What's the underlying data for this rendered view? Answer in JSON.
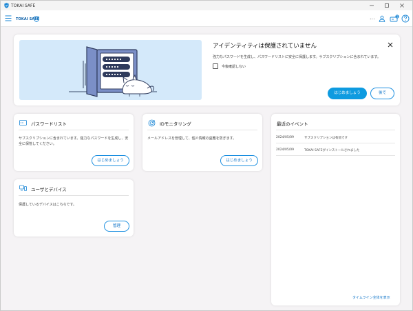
{
  "window": {
    "title": "TOKAI SAFE"
  },
  "toolbar": {
    "logo": "TOKAI SAFE",
    "more": "...",
    "badge": "1"
  },
  "banner": {
    "title": "アイデンティティは保護されていません",
    "description": "強力なパスワードを生成し、パスワードリストに安全に保護します。サブスクリプションに含まれています。",
    "checkbox_label": "今後確認しない",
    "start_button": "はじめましょう",
    "later_button": "後で"
  },
  "password_card": {
    "title": "パスワードリスト",
    "description": "サブスクリプションに含まれています。強力なパスワードを生成し、安全に保管してください。",
    "button": "はじめましょう"
  },
  "id_card": {
    "title": "IDモニタリング",
    "description": "メールアドレスを管理して、個人情報の盗難を防ぎます。",
    "button": "はじめましょう"
  },
  "users_card": {
    "title": "ユーザとデバイス",
    "description": "保護しているデバイスはこちらです。",
    "button": "管理"
  },
  "events": {
    "title": "最近のイベント",
    "items": [
      {
        "date": "2024/05/09",
        "text": "サブスクリプションは有効です"
      },
      {
        "date": "2024/05/09",
        "text": "TOKAI SAFEがインストールされました"
      }
    ],
    "timeline_link": "タイムライン全体を表示"
  },
  "colors": {
    "accent": "#0e9be0",
    "link": "#1276c9",
    "illustration_bg": "#d4e9fa"
  }
}
